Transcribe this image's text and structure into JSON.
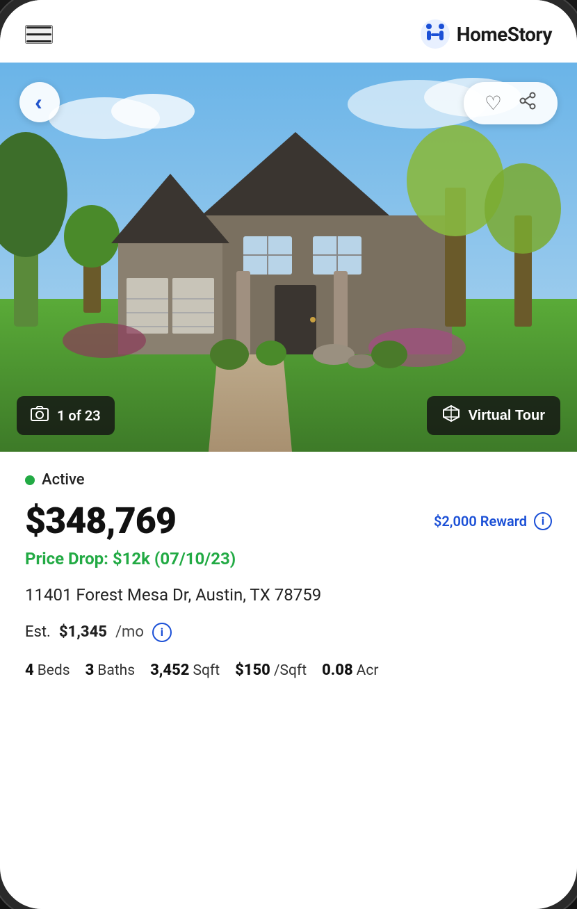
{
  "header": {
    "logo_text": "HomeStory",
    "menu_label": "Menu"
  },
  "image": {
    "counter_text": "1 of 23",
    "virtual_tour_label": "Virtual Tour",
    "photo_icon": "🖼",
    "cube_icon": "⬡",
    "total_photos": 23,
    "current_photo": 1
  },
  "listing": {
    "status": "Active",
    "status_color": "#22aa44",
    "price": "$348,769",
    "reward_text": "$2,000 Reward",
    "price_drop": "Price Drop: $12k (07/10/23)",
    "address": "11401 Forest Mesa Dr, Austin, TX 78759",
    "est_payment_prefix": "Est.",
    "est_payment_amount": "$1,345",
    "est_payment_suffix": "/mo",
    "beds": "4",
    "beds_label": "Beds",
    "baths": "3",
    "baths_label": "Baths",
    "sqft": "3,452",
    "sqft_label": "Sqft",
    "price_per_sqft": "$150",
    "price_per_sqft_label": "/Sqft",
    "acres": "0.08",
    "acres_label": "Acr"
  },
  "nav": {
    "back_label": "Back",
    "heart_label": "Save",
    "share_label": "Share"
  }
}
